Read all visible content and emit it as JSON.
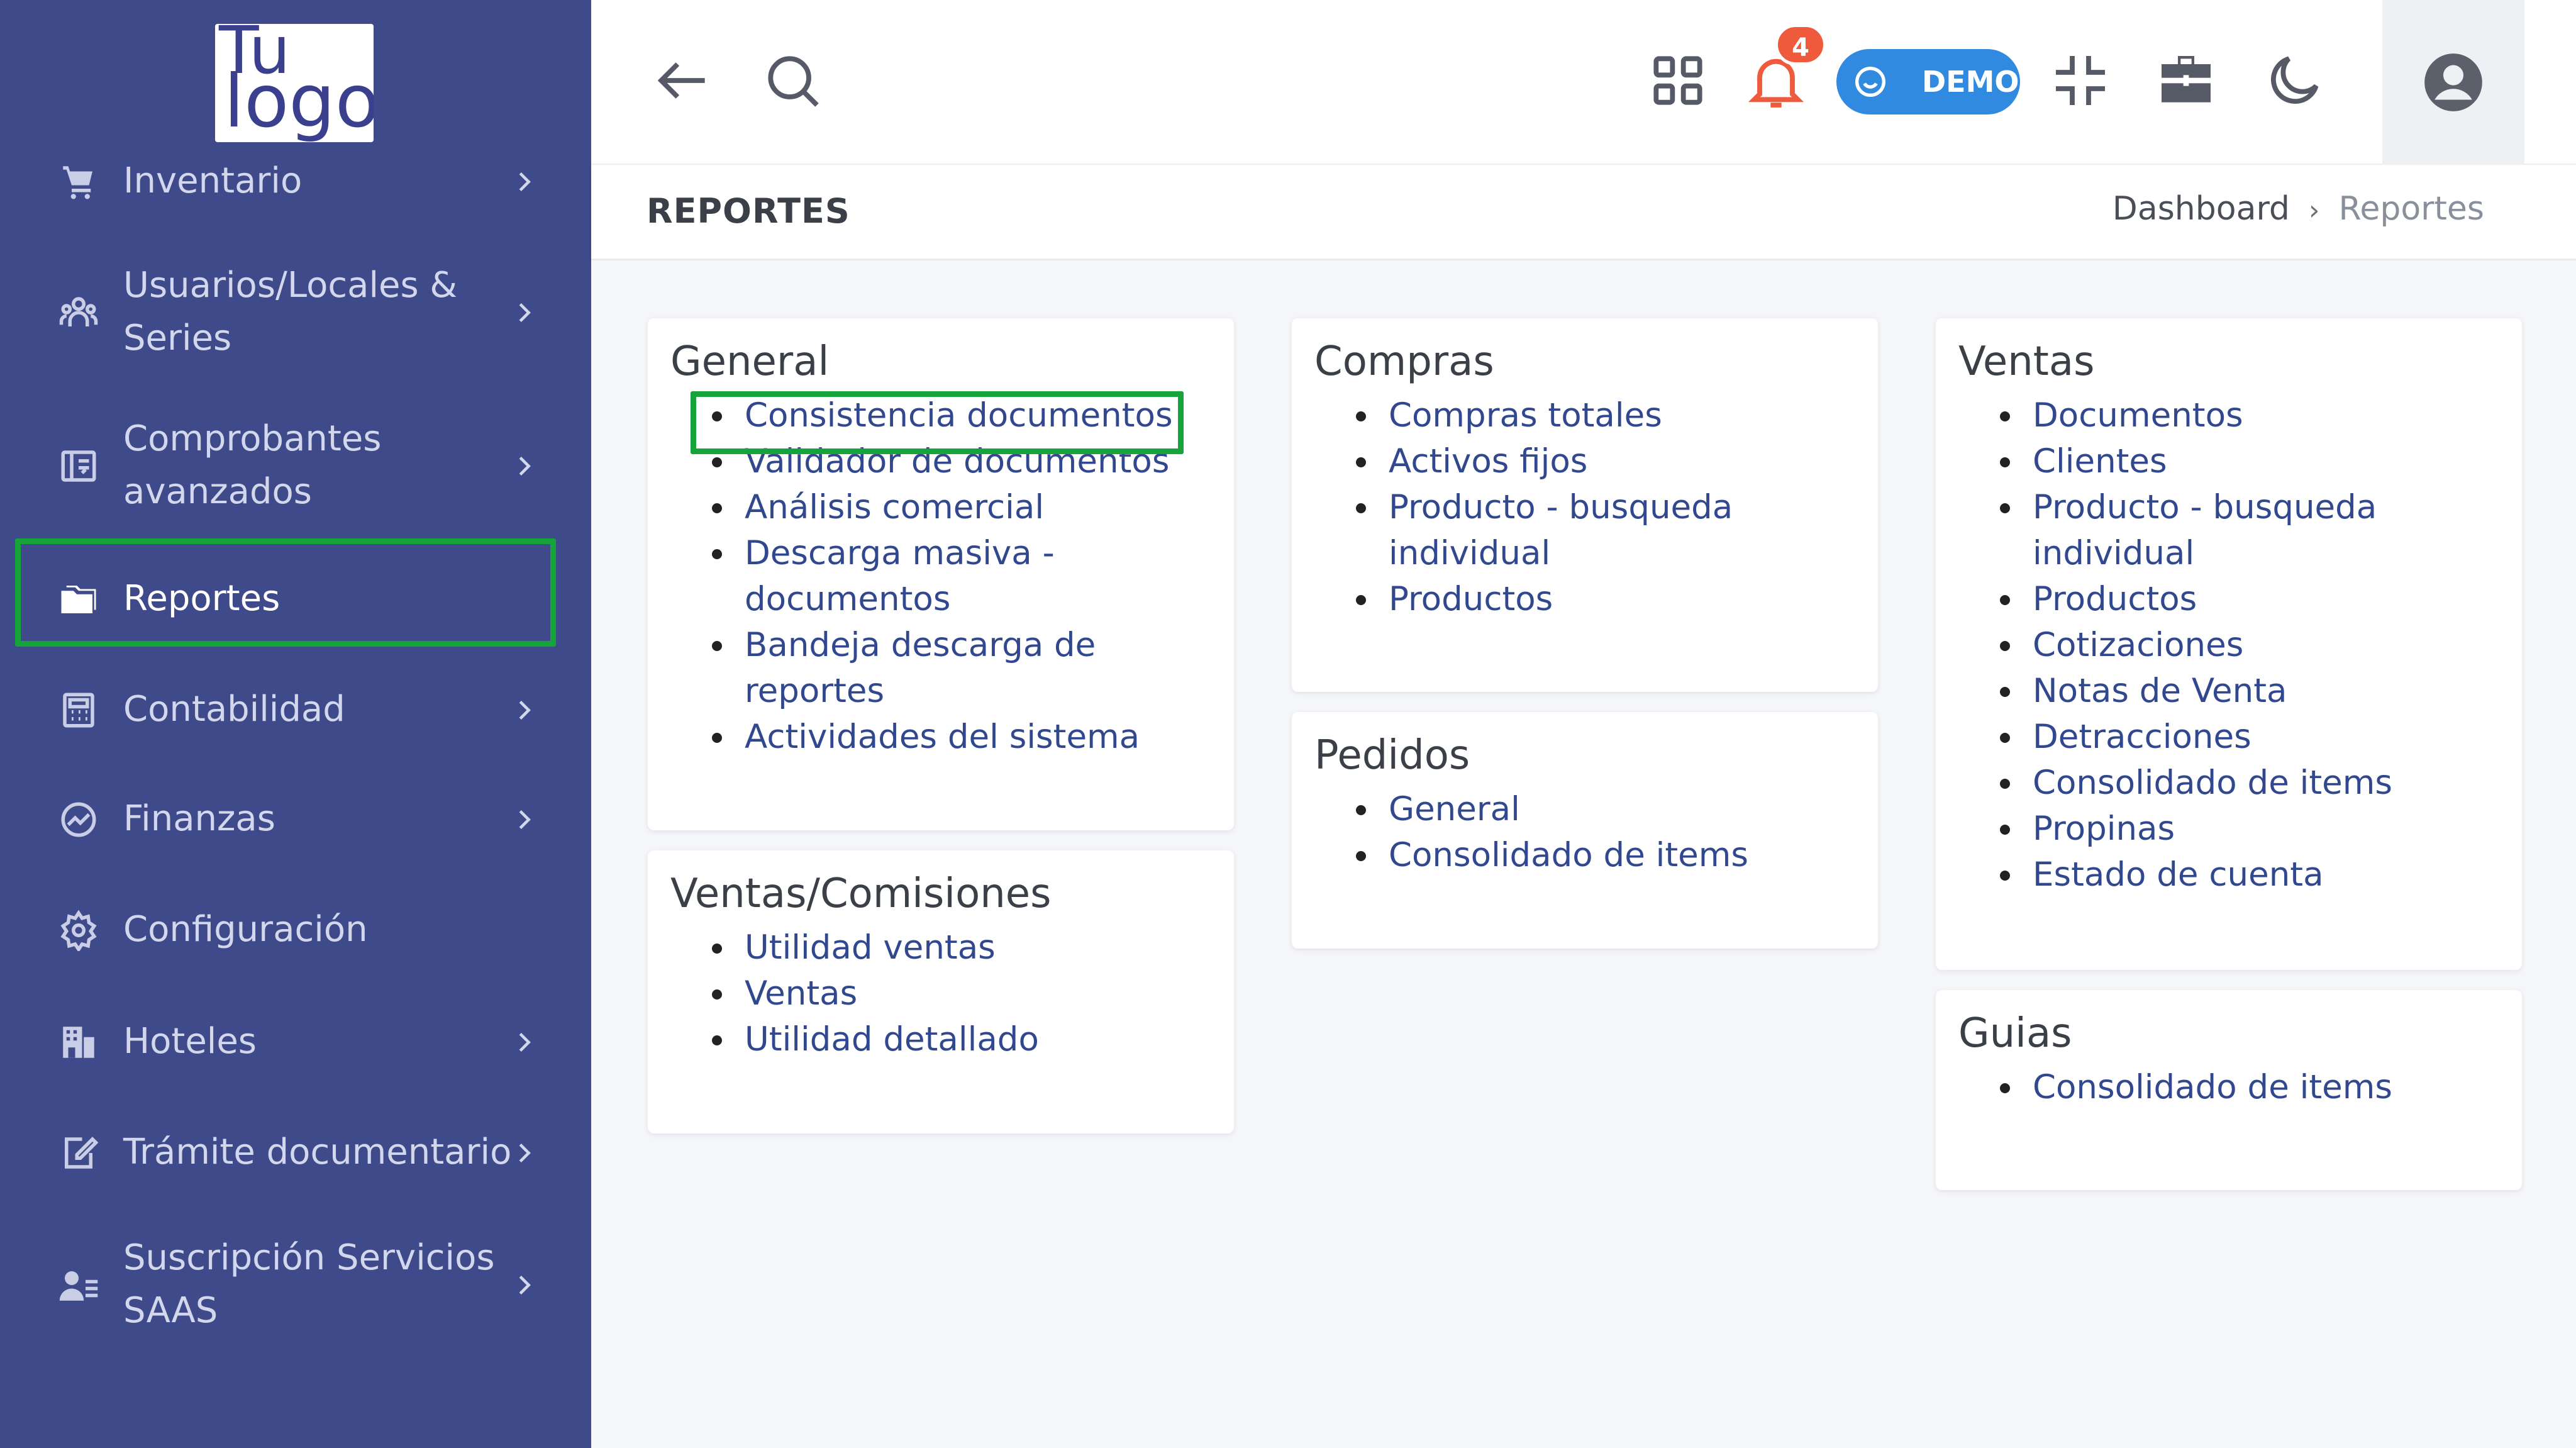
{
  "logo": {
    "line1": "Tu",
    "line2": "logo"
  },
  "sidebar": {
    "items": [
      {
        "label": "Inventario",
        "icon": "cart-icon",
        "chevron": true,
        "active": false
      },
      {
        "label": "Usuarios/Locales &",
        "label2": "Series",
        "icon": "users-icon",
        "chevron": true,
        "active": false
      },
      {
        "label": "Comprobantes",
        "label2": "avanzados",
        "icon": "receipt-icon",
        "chevron": true,
        "active": false
      },
      {
        "label": "Reportes",
        "icon": "folder-icon",
        "chevron": false,
        "active": true
      },
      {
        "label": "Contabilidad",
        "icon": "calculator-icon",
        "chevron": true,
        "active": false
      },
      {
        "label": "Finanzas",
        "icon": "chart-circle-icon",
        "chevron": true,
        "active": false
      },
      {
        "label": "Configuración",
        "icon": "gear-icon",
        "chevron": false,
        "active": false
      },
      {
        "label": "Hoteles",
        "icon": "building-icon",
        "chevron": true,
        "active": false
      },
      {
        "label": "Trámite documentario",
        "icon": "edit-document-icon",
        "chevron": true,
        "active": false
      },
      {
        "label": "Suscripción Servicios",
        "label2": "SAAS",
        "icon": "user-list-icon",
        "chevron": true,
        "active": false
      }
    ]
  },
  "topbar": {
    "notifications_count": "4",
    "demo_label": "DEMO"
  },
  "page": {
    "title": "REPORTES",
    "breadcrumb": [
      "Dashboard",
      "Reportes"
    ]
  },
  "cards": {
    "general": {
      "title": "General",
      "items": [
        "Consistencia documentos",
        "Validador de documentos",
        "Análisis comercial",
        "Descarga masiva -",
        "documentos",
        "Bandeja descarga de",
        "reportes",
        "Actividades del sistema"
      ]
    },
    "ventas_comisiones": {
      "title": "Ventas/Comisiones",
      "items": [
        "Utilidad ventas",
        "Ventas",
        "Utilidad detallado"
      ]
    },
    "compras": {
      "title": "Compras",
      "items": [
        "Compras totales",
        "Activos fijos",
        "Producto - busqueda",
        "individual",
        "Productos"
      ]
    },
    "pedidos": {
      "title": "Pedidos",
      "items": [
        "General",
        "Consolidado de items"
      ]
    },
    "ventas": {
      "title": "Ventas",
      "items": [
        "Documentos",
        "Clientes",
        "Producto - busqueda",
        "individual",
        "Productos",
        "Cotizaciones",
        "Notas de Venta",
        "Detracciones",
        "Consolidado de items",
        "Propinas",
        "Estado de cuenta"
      ]
    },
    "guias": {
      "title": "Guias",
      "items": [
        "Consolidado de items"
      ]
    }
  },
  "colors": {
    "sidebar_bg": "#3e4a8a",
    "link": "#31488f",
    "highlight": "#15a33a",
    "demo_pill": "#2f8ae0",
    "badge": "#ee5a3b"
  }
}
